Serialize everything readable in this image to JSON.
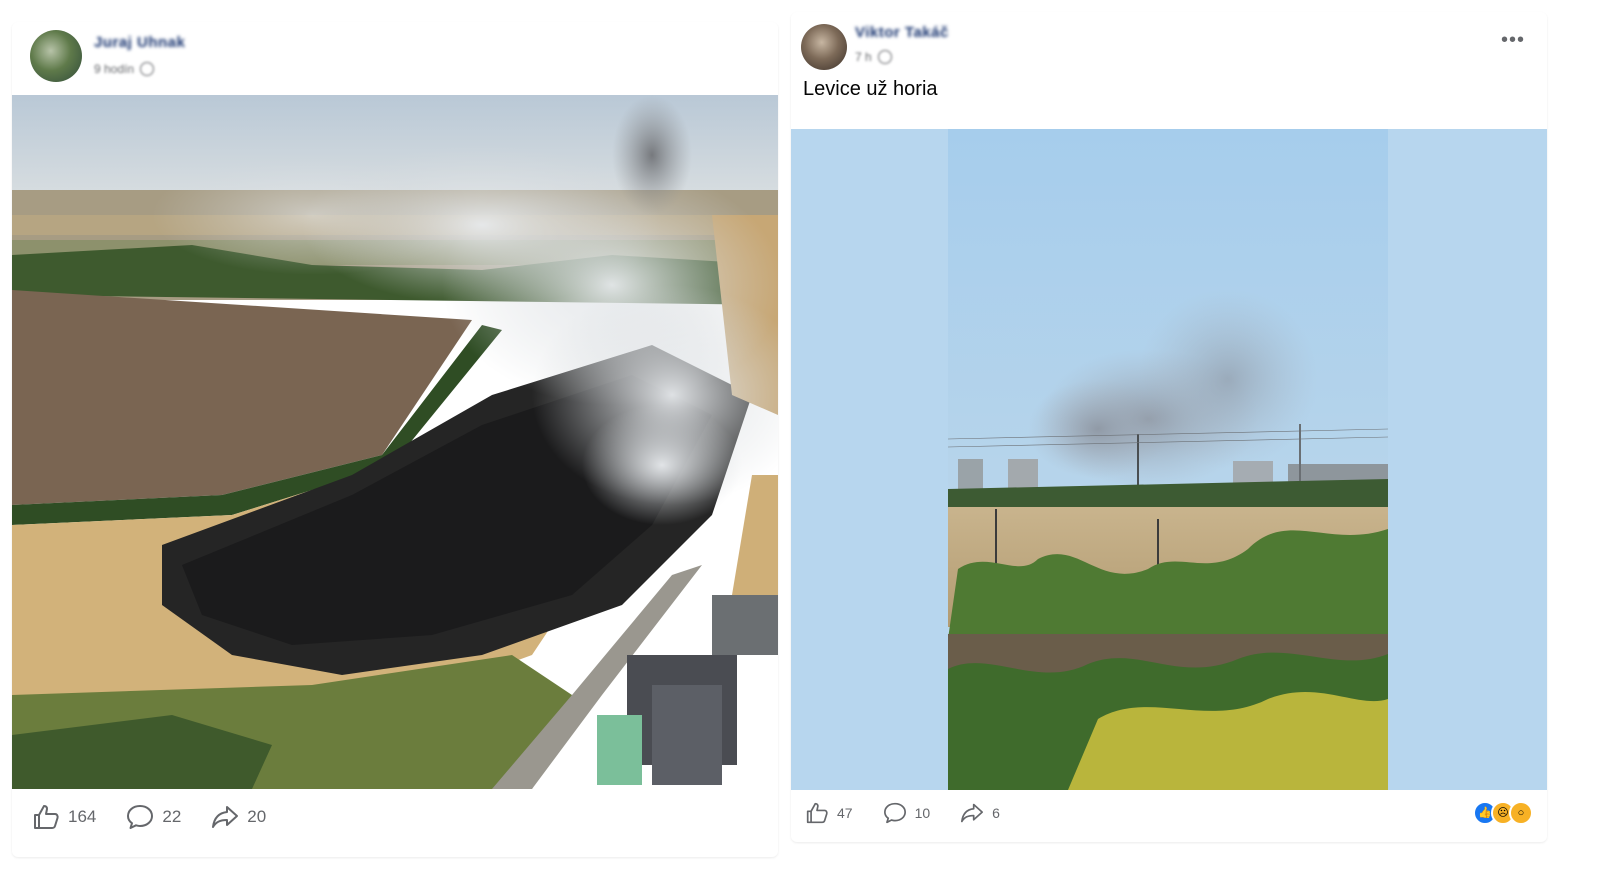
{
  "posts": [
    {
      "author": "Juraj Uhnak",
      "time": "9 hodín",
      "text": "",
      "stats": {
        "likes": "164",
        "comments": "22",
        "shares": "20"
      },
      "image_icon": "aerial-wildfire-photo"
    },
    {
      "author": "Viktor Takáč",
      "time": "7 h",
      "text": "Levice už horia",
      "stats": {
        "likes": "47",
        "comments": "10",
        "shares": "6"
      },
      "image_icon": "smoke-over-town-photo",
      "reactions": [
        "like-reaction-icon",
        "sad-reaction-icon",
        "wow-reaction-icon"
      ]
    }
  ],
  "icons": {
    "like": "thumb-up-icon",
    "comment": "comment-bubble-icon",
    "share": "share-arrow-icon",
    "more": "more-options-icon",
    "globe": "globe-icon"
  },
  "colors": {
    "text_secondary": "#65676b",
    "like_blue": "#1877f2",
    "reaction_yellow": "#f7b125"
  }
}
